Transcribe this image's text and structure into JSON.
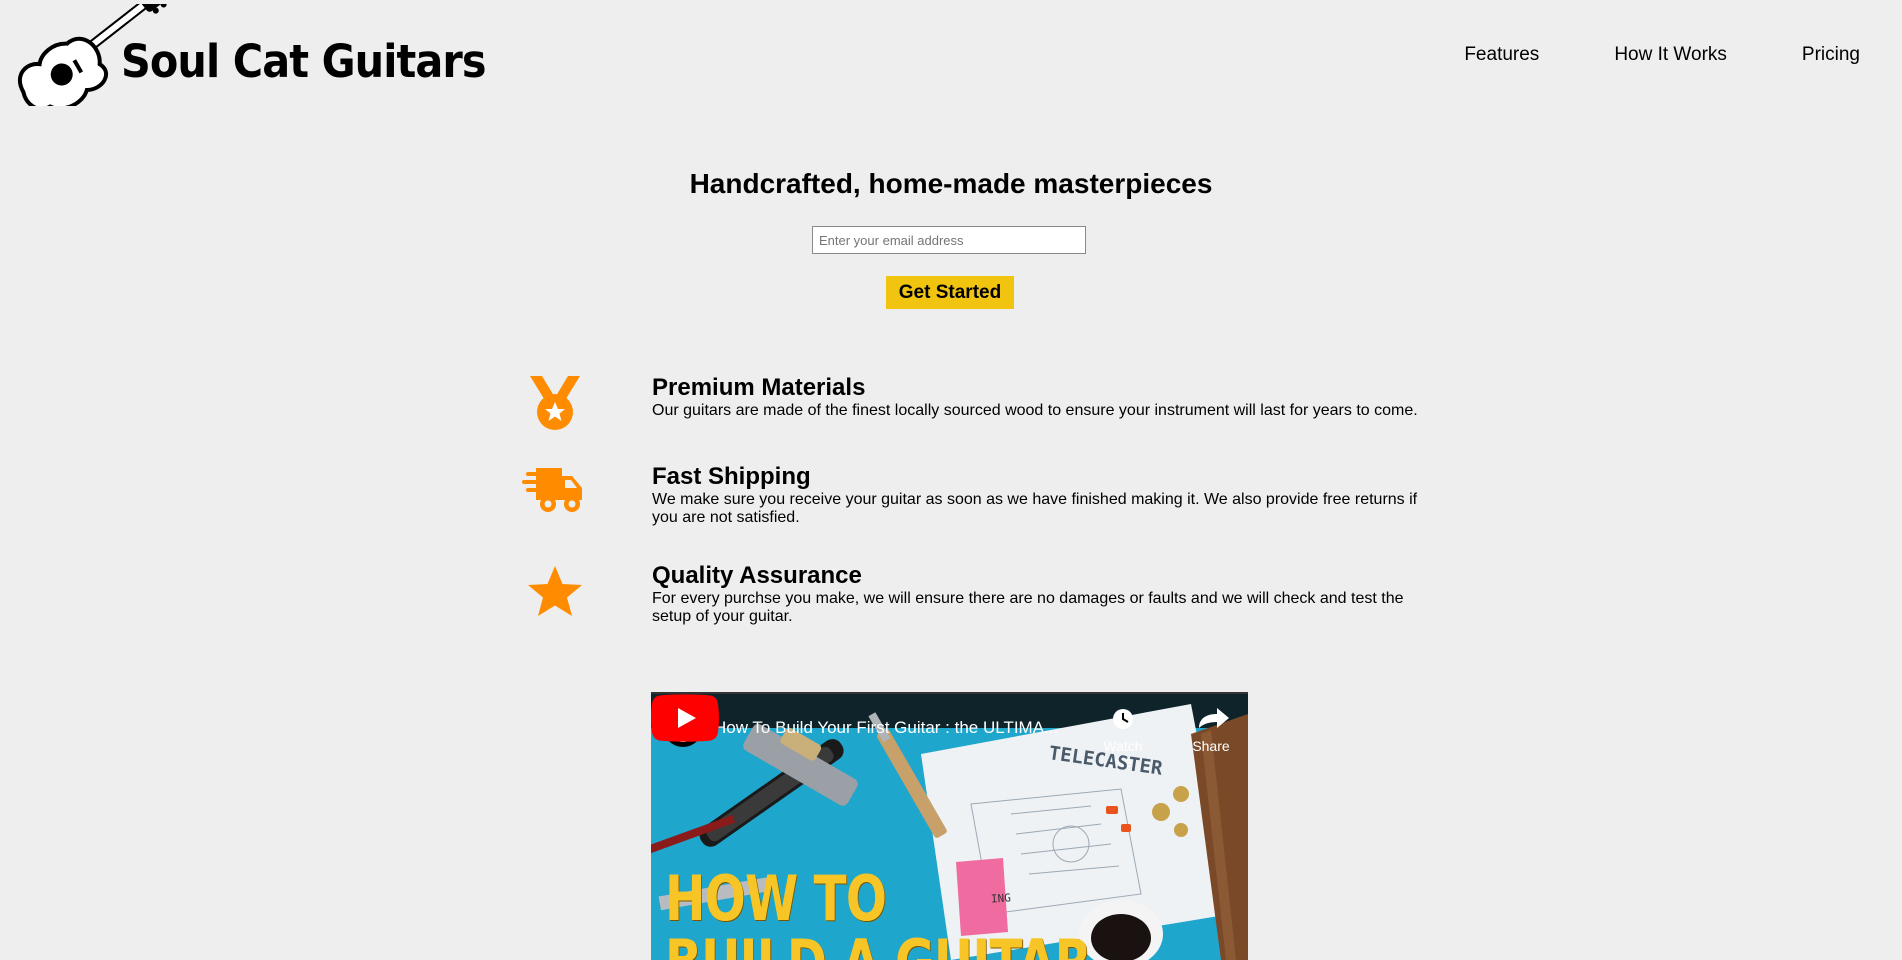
{
  "header": {
    "brand": "Soul Cat Guitars",
    "nav": [
      "Features",
      "How It Works",
      "Pricing"
    ]
  },
  "hero": {
    "title": "Handcrafted, home-made masterpieces",
    "email_placeholder": "Enter your email address",
    "cta_label": "Get Started"
  },
  "features": [
    {
      "icon": "medal-icon",
      "title": "Premium Materials",
      "text": "Our guitars are made of the finest locally sourced wood to ensure your instrument will last for years to come."
    },
    {
      "icon": "shipping-truck-icon",
      "title": "Fast Shipping",
      "text": "We make sure you receive your guitar as soon as we have finished making it. We also provide free returns if you are not satisfied."
    },
    {
      "icon": "star-icon",
      "title": "Quality Assurance",
      "text": "For every purchse you make, we will ensure there are no damages or faults and we will check and test the setup of your guitar."
    }
  ],
  "video": {
    "title": "How To Build Your First Guitar : the ULTIMA...",
    "watch_later": "Watch later",
    "share": "Share",
    "thumbnail_line1": "HOW TO",
    "thumbnail_line2": "BUILD A GUITAR",
    "thumbnail_label": "TELECASTER",
    "sticky_note": "ING"
  },
  "colors": {
    "background": "#eeeeee",
    "accent_orange": "#ff8c00",
    "cta_yellow": "#f1c40f",
    "youtube_red": "#ff0000"
  }
}
